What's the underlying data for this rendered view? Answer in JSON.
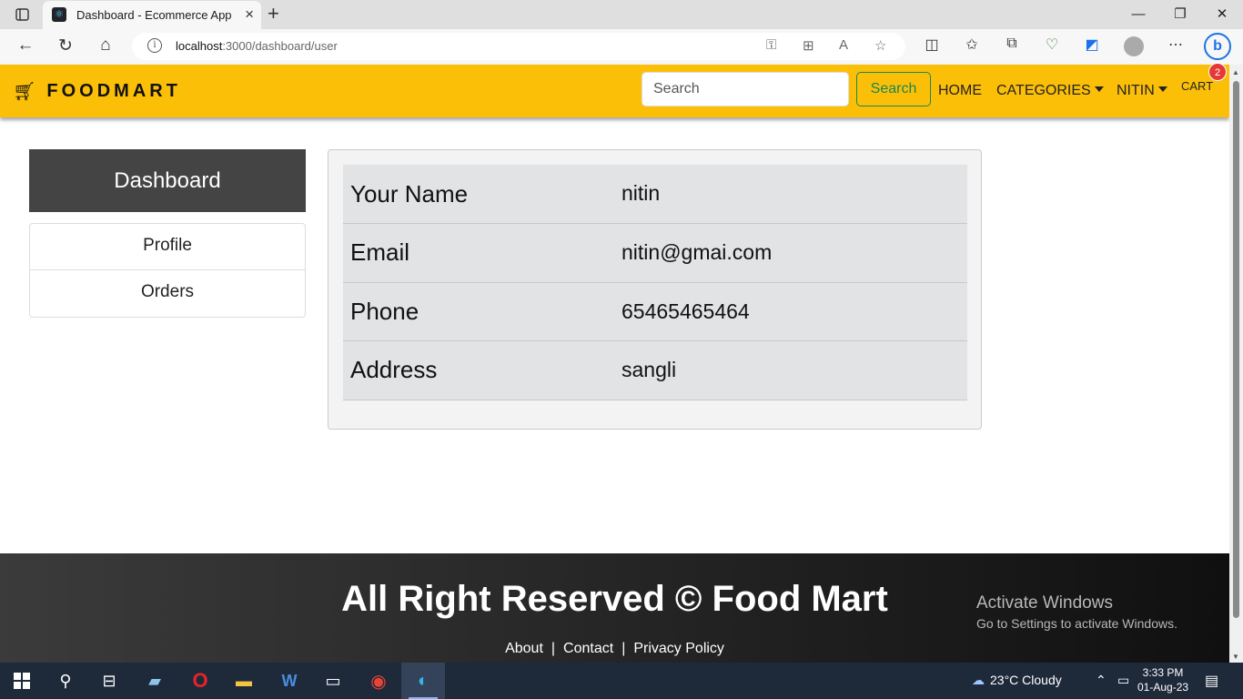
{
  "browser": {
    "tab_title": "Dashboard - Ecommerce App",
    "url_host": "localhost",
    "url_path": ":3000/dashboard/user",
    "icons": [
      "tab-actions-icon",
      "react-favicon-icon",
      "close-icon",
      "new-tab-icon",
      "minimize-icon",
      "restore-icon",
      "close-window-icon",
      "back-icon",
      "refresh-icon",
      "home-icon",
      "info-icon",
      "key-icon",
      "apps-icon",
      "read-aloud-icon",
      "favorite-star-icon",
      "split-screen-icon",
      "favorites-icon",
      "collections-icon",
      "health-icon",
      "copilot-icon",
      "profile-icon",
      "more-icon",
      "bing-icon"
    ]
  },
  "navbar": {
    "brand": "FOODMART",
    "search_placeholder": "Search",
    "search_button": "Search",
    "home": "HOME",
    "categories": "CATEGORIES",
    "user": "NITIN",
    "cart": "CART",
    "cart_count": "2",
    "accent_color": "#fcbf08"
  },
  "sidebar": {
    "title": "Dashboard",
    "items": [
      {
        "label": "Profile"
      },
      {
        "label": "Orders"
      }
    ]
  },
  "user_info": {
    "rows": [
      {
        "label": "Your Name",
        "value": "nitin"
      },
      {
        "label": "Email",
        "value": "nitin@gmai.com"
      },
      {
        "label": "Phone",
        "value": "65465465464"
      },
      {
        "label": "Address",
        "value": "sangli"
      }
    ]
  },
  "footer": {
    "title": "All Right Reserved © Food Mart",
    "links": [
      "About",
      "Contact",
      "Privacy Policy"
    ],
    "separator": "|"
  },
  "watermark": {
    "line1": "Activate Windows",
    "line2": "Go to Settings to activate Windows."
  },
  "taskbar": {
    "weather": "23°C  Cloudy",
    "time": "3:33 PM",
    "date": "01-Aug-23"
  }
}
